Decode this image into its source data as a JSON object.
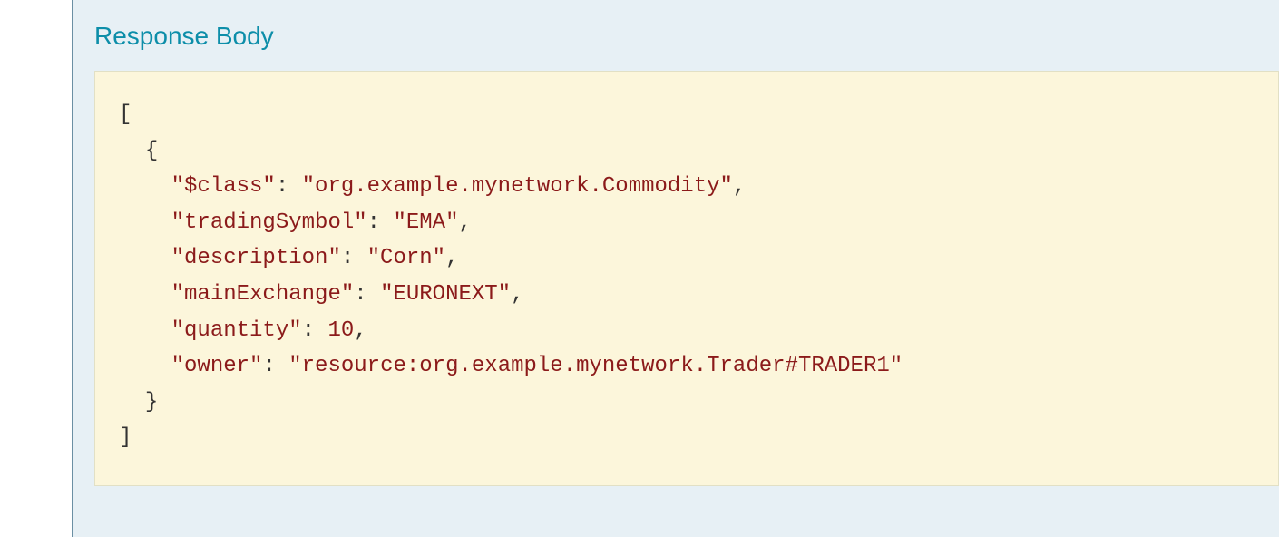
{
  "header": {
    "title": "Response Body"
  },
  "responseBody": {
    "keys": {
      "class": "\"$class\"",
      "tradingSymbol": "\"tradingSymbol\"",
      "description": "\"description\"",
      "mainExchange": "\"mainExchange\"",
      "quantity": "\"quantity\"",
      "owner": "\"owner\""
    },
    "values": {
      "class": "\"org.example.mynetwork.Commodity\"",
      "tradingSymbol": "\"EMA\"",
      "description": "\"Corn\"",
      "mainExchange": "\"EURONEXT\"",
      "quantity": "10",
      "owner": "\"resource:org.example.mynetwork.Trader#TRADER1\""
    }
  }
}
